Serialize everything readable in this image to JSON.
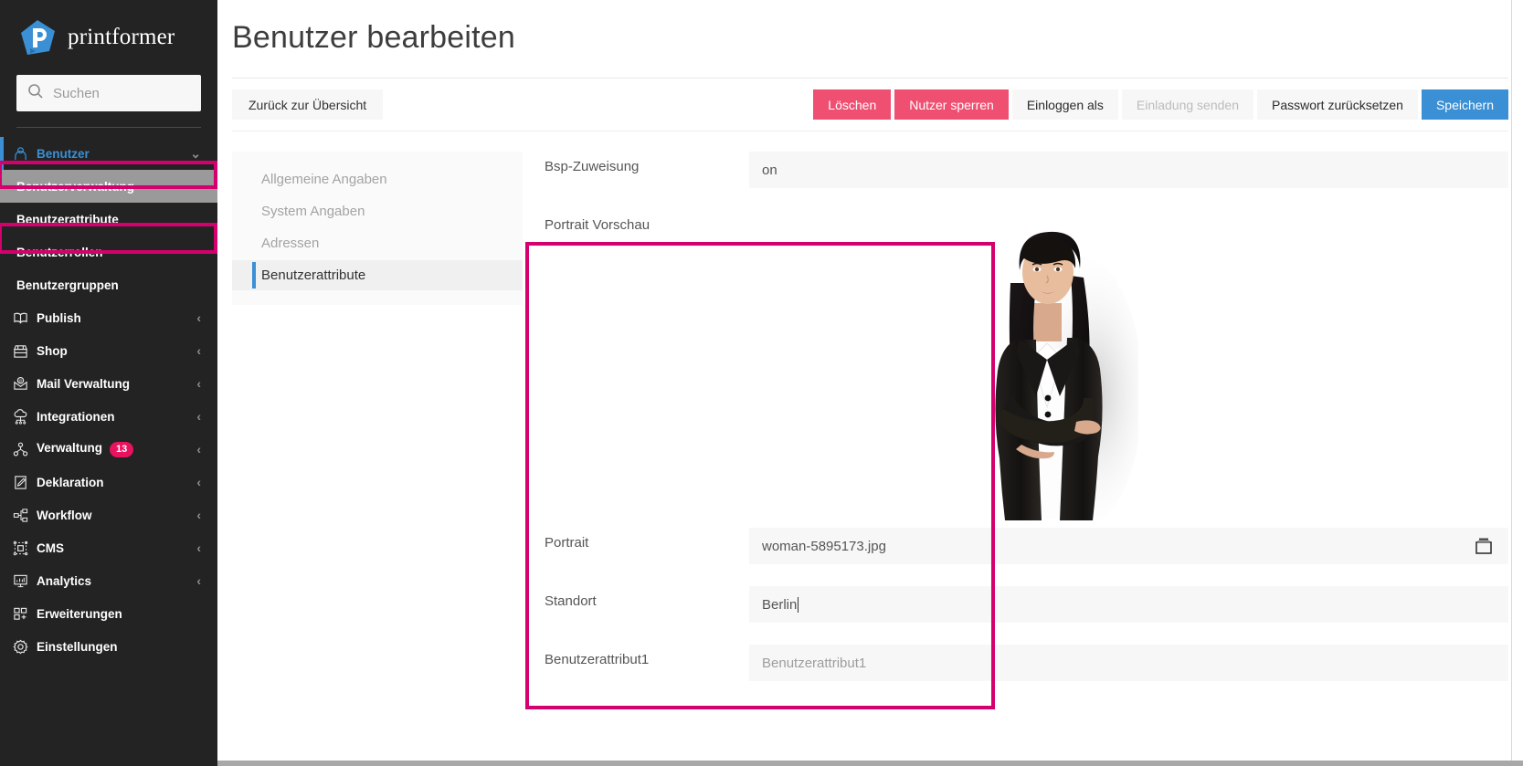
{
  "brand": {
    "name": "printformer",
    "logo_icon": "printformer-logo-icon"
  },
  "search": {
    "placeholder": "Suchen",
    "value": "",
    "icon": "search-icon"
  },
  "sidebar": {
    "parent": {
      "label": "Benutzer",
      "icon": "user-icon",
      "chevron": "chevron-down-icon"
    },
    "sub_items": [
      {
        "label": "Benutzerverwaltung",
        "selected": true
      },
      {
        "label": "Benutzerattribute",
        "selected": false
      },
      {
        "label": "Benutzerrollen",
        "selected": false
      },
      {
        "label": "Benutzergruppen",
        "selected": false
      }
    ],
    "items": [
      {
        "label": "Publish",
        "icon": "book-icon",
        "chevron": "chevron-left-icon",
        "badge": ""
      },
      {
        "label": "Shop",
        "icon": "shop-icon",
        "chevron": "chevron-left-icon",
        "badge": ""
      },
      {
        "label": "Mail Verwaltung",
        "icon": "mail-icon",
        "chevron": "chevron-left-icon",
        "badge": ""
      },
      {
        "label": "Integrationen",
        "icon": "cloud-nodes-icon",
        "chevron": "chevron-left-icon",
        "badge": ""
      },
      {
        "label": "Verwaltung",
        "icon": "network-icon",
        "chevron": "chevron-left-icon",
        "badge": "13"
      },
      {
        "label": "Deklaration",
        "icon": "edit-document-icon",
        "chevron": "chevron-left-icon",
        "badge": ""
      },
      {
        "label": "Workflow",
        "icon": "workflow-icon",
        "chevron": "chevron-left-icon",
        "badge": ""
      },
      {
        "label": "CMS",
        "icon": "cms-icon",
        "chevron": "chevron-left-icon",
        "badge": ""
      },
      {
        "label": "Analytics",
        "icon": "analytics-icon",
        "chevron": "chevron-left-icon",
        "badge": ""
      },
      {
        "label": "Erweiterungen",
        "icon": "extensions-icon",
        "chevron": "",
        "badge": ""
      },
      {
        "label": "Einstellungen",
        "icon": "gear-icon",
        "chevron": "",
        "badge": ""
      }
    ]
  },
  "header": {
    "title": "Benutzer bearbeiten"
  },
  "toolbar": {
    "back_label": "Zurück zur Übersicht",
    "delete_label": "Löschen",
    "block_label": "Nutzer sperren",
    "login_as_label": "Einloggen als",
    "invite_label": "Einladung senden",
    "reset_password_label": "Passwort zurücksetzen",
    "save_label": "Speichern"
  },
  "tabs": [
    {
      "label": "Allgemeine Angaben",
      "selected": false
    },
    {
      "label": "System Angaben",
      "selected": false
    },
    {
      "label": "Adressen",
      "selected": false
    },
    {
      "label": "Benutzerattribute",
      "selected": true
    }
  ],
  "form": {
    "rows": [
      {
        "label": "Bsp-Zuweisung",
        "value": "on",
        "placeholder": ""
      },
      {
        "label": "Portrait Vorschau",
        "value": "",
        "placeholder": ""
      },
      {
        "label": "Portrait",
        "value": "woman-5895173.jpg",
        "placeholder": "",
        "icon": "trash-icon"
      },
      {
        "label": "Standort",
        "value": "Berlin",
        "placeholder": ""
      },
      {
        "label": "Benutzerattribut1",
        "value": "",
        "placeholder": "Benutzerattribut1"
      }
    ]
  },
  "colors": {
    "sidebar_bg": "#232323",
    "accent_blue": "#3b8fd4",
    "danger_pink": "#ef5072",
    "badge_pink": "#e8135e",
    "highlight_magenta": "#d4006e",
    "field_bg": "#f7f7f7"
  },
  "annotations": {
    "highlight_count": 3,
    "highlight_color": "#d4006e"
  }
}
